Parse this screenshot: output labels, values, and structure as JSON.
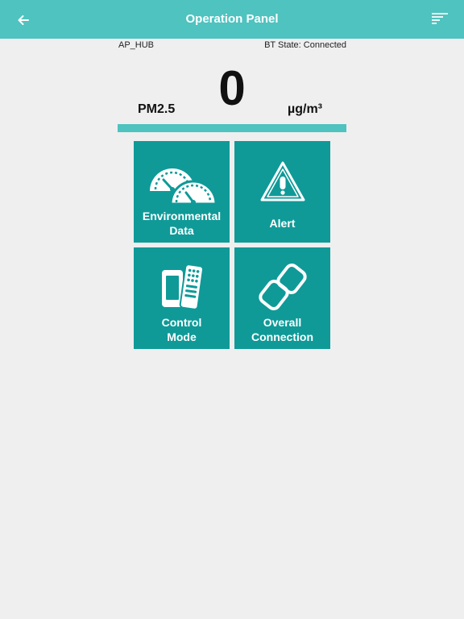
{
  "appbar": {
    "title": "Operation Panel",
    "back_icon": "back-arrow-icon",
    "menu_icon": "sort-menu-icon",
    "color": "#4ec3bf"
  },
  "status": {
    "device": "AP_HUB",
    "bt_state": "BT State: Connected"
  },
  "reading": {
    "label": "PM2.5",
    "value": "0",
    "unit": "µg/m³",
    "bar_fill_percent": 100
  },
  "tiles": [
    {
      "line1": "Environmental",
      "line2": "Data",
      "icon": "gauge-icon"
    },
    {
      "line1": "Alert",
      "icon": "warning-icon"
    },
    {
      "line1": "Control",
      "line2": "Mode",
      "icon": "phone-remote-icon"
    },
    {
      "line1": "Overall",
      "line2": "Connection",
      "icon": "link-icon"
    }
  ],
  "colors": {
    "tile": "#0f9a98",
    "background": "#efefef"
  }
}
